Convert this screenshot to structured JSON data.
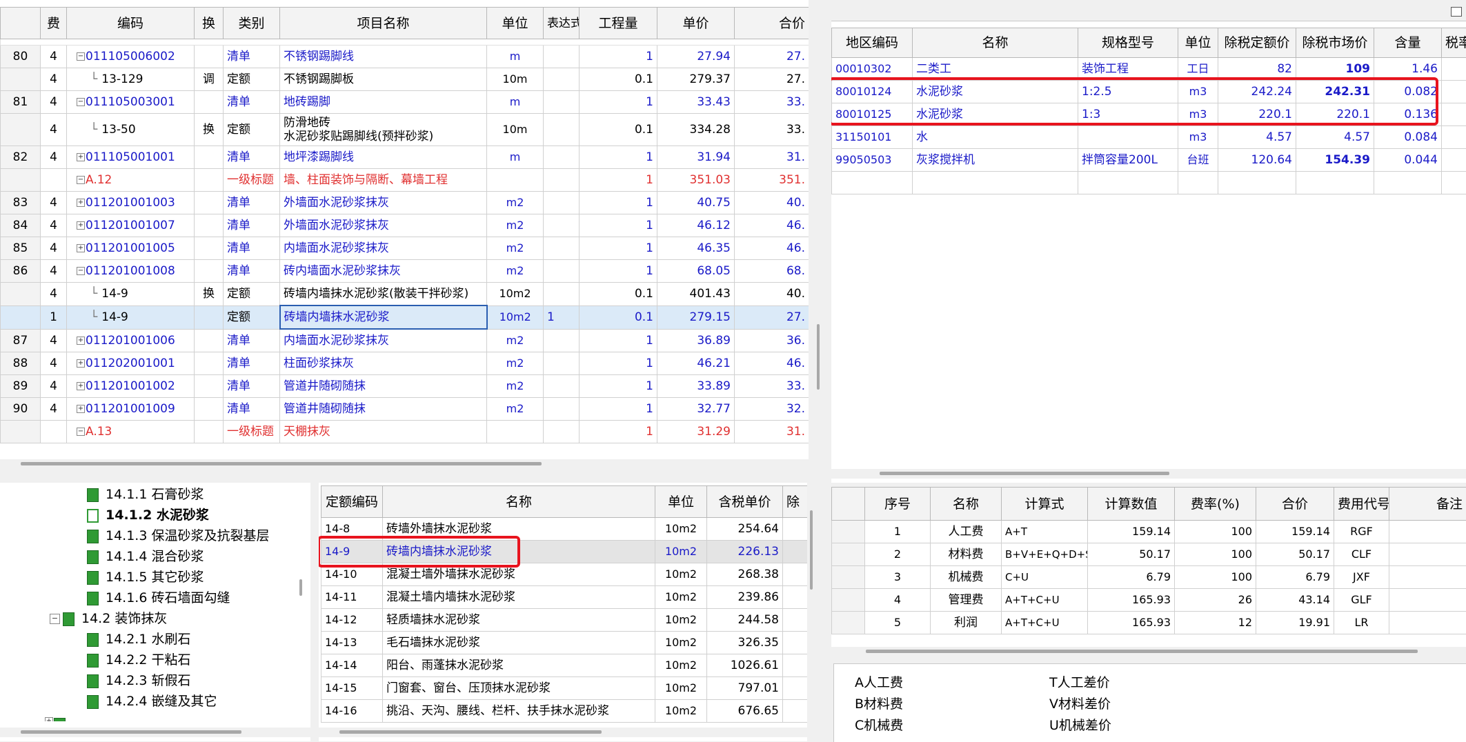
{
  "main_grid": {
    "headers": [
      "费",
      "编码",
      "换",
      "类别",
      "项目名称",
      "单位",
      "表达式",
      "工程量",
      "单价",
      "合价"
    ],
    "rows": [
      {
        "no": "80",
        "fee": "4",
        "code": "011105006002",
        "tree": "minus",
        "indent": 0,
        "swap": "",
        "type": "清单",
        "name": "不锈钢踢脚线",
        "unit": "m",
        "expr": "",
        "qty": "1",
        "price": "27.94",
        "total": "27.",
        "style": "blue"
      },
      {
        "no": "",
        "fee": "4",
        "code": "13-129",
        "tree": "leaf",
        "indent": 1,
        "swap": "调",
        "type": "定额",
        "name": "不锈钢踢脚板",
        "unit": "10m",
        "expr": "",
        "qty": "0.1",
        "price": "279.37",
        "total": "27.",
        "style": "black"
      },
      {
        "no": "81",
        "fee": "4",
        "code": "011105003001",
        "tree": "minus",
        "indent": 0,
        "swap": "",
        "type": "清单",
        "name": "地砖踢脚",
        "unit": "m",
        "expr": "",
        "qty": "1",
        "price": "33.43",
        "total": "33.",
        "style": "blue"
      },
      {
        "no": "",
        "fee": "4",
        "code": "13-50",
        "tree": "leaf",
        "indent": 1,
        "swap": "换",
        "type": "定额",
        "name": "防滑地砖",
        "name2": "水泥砂浆贴踢脚线(预拌砂浆)",
        "unit": "10m",
        "expr": "",
        "qty": "0.1",
        "price": "334.28",
        "total": "33.",
        "style": "black",
        "tall": true
      },
      {
        "no": "82",
        "fee": "4",
        "code": "011105001001",
        "tree": "plus",
        "indent": 0,
        "swap": "",
        "type": "清单",
        "name": "地坪漆踢脚线",
        "unit": "m",
        "expr": "",
        "qty": "1",
        "price": "31.94",
        "total": "31.",
        "style": "blue"
      },
      {
        "no": "",
        "fee": "",
        "code": "A.12",
        "tree": "minus",
        "indent": 0,
        "swap": "",
        "type": "一级标题",
        "name": "墙、柱面装饰与隔断、幕墙工程",
        "unit": "",
        "expr": "",
        "qty": "1",
        "price": "351.03",
        "total": "351.",
        "style": "red"
      },
      {
        "no": "83",
        "fee": "4",
        "code": "011201001003",
        "tree": "plus",
        "indent": 0,
        "swap": "",
        "type": "清单",
        "name": "外墙面水泥砂浆抹灰",
        "unit": "m2",
        "expr": "",
        "qty": "1",
        "price": "40.75",
        "total": "40.",
        "style": "blue"
      },
      {
        "no": "84",
        "fee": "4",
        "code": "011201001007",
        "tree": "plus",
        "indent": 0,
        "swap": "",
        "type": "清单",
        "name": "外墙面水泥砂浆抹灰",
        "unit": "m2",
        "expr": "",
        "qty": "1",
        "price": "46.12",
        "total": "46.",
        "style": "blue"
      },
      {
        "no": "85",
        "fee": "4",
        "code": "011201001005",
        "tree": "plus",
        "indent": 0,
        "swap": "",
        "type": "清单",
        "name": "内墙面水泥砂浆抹灰",
        "unit": "m2",
        "expr": "",
        "qty": "1",
        "price": "46.35",
        "total": "46.",
        "style": "blue"
      },
      {
        "no": "86",
        "fee": "4",
        "code": "011201001008",
        "tree": "minus",
        "indent": 0,
        "swap": "",
        "type": "清单",
        "name": "砖内墙面水泥砂浆抹灰",
        "unit": "m2",
        "expr": "",
        "qty": "1",
        "price": "68.05",
        "total": "68.",
        "style": "blue"
      },
      {
        "no": "",
        "fee": "4",
        "code": "14-9",
        "tree": "leaf",
        "indent": 1,
        "swap": "换",
        "type": "定额",
        "name": "砖墙内墙抹水泥砂浆(散装干拌砂浆)",
        "unit": "10m2",
        "expr": "",
        "qty": "0.1",
        "price": "401.43",
        "total": "40.",
        "style": "black"
      },
      {
        "no": "",
        "fee": "1",
        "code": "14-9",
        "tree": "leaf",
        "indent": 1,
        "swap": "",
        "type": "定额",
        "name": "砖墙内墙抹水泥砂浆",
        "unit": "10m2",
        "expr": "1",
        "qty": "0.1",
        "price": "279.15",
        "total": "27.",
        "style": "selected"
      },
      {
        "no": "87",
        "fee": "4",
        "code": "011201001006",
        "tree": "plus",
        "indent": 0,
        "swap": "",
        "type": "清单",
        "name": "内墙面水泥砂浆抹灰",
        "unit": "m2",
        "expr": "",
        "qty": "1",
        "price": "36.89",
        "total": "36.",
        "style": "blue"
      },
      {
        "no": "88",
        "fee": "4",
        "code": "011202001001",
        "tree": "plus",
        "indent": 0,
        "swap": "",
        "type": "清单",
        "name": "柱面砂浆抹灰",
        "unit": "m2",
        "expr": "",
        "qty": "1",
        "price": "46.21",
        "total": "46.",
        "style": "blue"
      },
      {
        "no": "89",
        "fee": "4",
        "code": "011201001002",
        "tree": "plus",
        "indent": 0,
        "swap": "",
        "type": "清单",
        "name": "管道井随砌随抹",
        "unit": "m2",
        "expr": "",
        "qty": "1",
        "price": "33.89",
        "total": "33.",
        "style": "blue"
      },
      {
        "no": "90",
        "fee": "4",
        "code": "011201001009",
        "tree": "plus",
        "indent": 0,
        "swap": "",
        "type": "清单",
        "name": "管道井随砌随抹",
        "unit": "m2",
        "expr": "",
        "qty": "1",
        "price": "32.77",
        "total": "32.",
        "style": "blue"
      },
      {
        "no": "",
        "fee": "",
        "code": "A.13",
        "tree": "minus",
        "indent": 0,
        "swap": "",
        "type": "一级标题",
        "name": "天棚抹灰",
        "unit": "",
        "expr": "",
        "qty": "1",
        "price": "31.29",
        "total": "31.",
        "style": "red"
      }
    ]
  },
  "material_grid": {
    "headers": [
      "地区编码",
      "名称",
      "规格型号",
      "单位",
      "除税定额价",
      "除税市场价",
      "含量",
      "税率("
    ],
    "rows": [
      {
        "code": "00010302",
        "name": "二类工",
        "spec": "装饰工程",
        "unit": "工日",
        "quota": "82",
        "market": "109",
        "qty": "1.46",
        "market_bold": true
      },
      {
        "code": "80010124",
        "name": "水泥砂浆",
        "spec": "1:2.5",
        "unit": "m3",
        "quota": "242.24",
        "market": "242.31",
        "qty": "0.082",
        "market_bold": true
      },
      {
        "code": "80010125",
        "name": "水泥砂浆",
        "spec": "1:3",
        "unit": "m3",
        "quota": "220.1",
        "market": "220.1",
        "qty": "0.136",
        "market_bold": false
      },
      {
        "code": "31150101",
        "name": "水",
        "spec": "",
        "unit": "m3",
        "quota": "4.57",
        "market": "4.57",
        "qty": "0.084",
        "market_bold": false
      },
      {
        "code": "99050503",
        "name": "灰浆搅拌机",
        "spec": "拌筒容量200L",
        "unit": "台班",
        "quota": "120.64",
        "market": "154.39",
        "qty": "0.044",
        "market_bold": true
      }
    ]
  },
  "category_tree": {
    "items": [
      {
        "label": "14.1.1  石膏砂浆",
        "level": 2,
        "open": false,
        "bold": false
      },
      {
        "label": "14.1.2  水泥砂浆",
        "level": 2,
        "open": true,
        "bold": true
      },
      {
        "label": "14.1.3  保温砂浆及抗裂基层",
        "level": 2,
        "open": false,
        "bold": false
      },
      {
        "label": "14.1.4  混合砂浆",
        "level": 2,
        "open": false,
        "bold": false
      },
      {
        "label": "14.1.5  其它砂浆",
        "level": 2,
        "open": false,
        "bold": false
      },
      {
        "label": "14.1.6  砖石墙面勾缝",
        "level": 2,
        "open": false,
        "bold": false
      },
      {
        "label": "14.2  装饰抹灰",
        "level": 1,
        "open": false,
        "bold": false,
        "expander": "minus"
      },
      {
        "label": "14.2.1  水刷石",
        "level": 2,
        "open": false,
        "bold": false
      },
      {
        "label": "14.2.2  干粘石",
        "level": 2,
        "open": false,
        "bold": false
      },
      {
        "label": "14.2.3  斩假石",
        "level": 2,
        "open": false,
        "bold": false
      },
      {
        "label": "14.2.4  嵌缝及其它",
        "level": 2,
        "open": false,
        "bold": false
      }
    ]
  },
  "quota_grid": {
    "headers": [
      "定额编码",
      "名称",
      "单位",
      "含税单价",
      "除"
    ],
    "rows": [
      {
        "code": "14-8",
        "name": "砖墙外墙抹水泥砂浆",
        "unit": "10m2",
        "price": "254.64"
      },
      {
        "code": "14-9",
        "name": "砖墙内墙抹水泥砂浆",
        "unit": "10m2",
        "price": "226.13",
        "highlight": true
      },
      {
        "code": "14-10",
        "name": "混凝土墙外墙抹水泥砂浆",
        "unit": "10m2",
        "price": "268.38"
      },
      {
        "code": "14-11",
        "name": "混凝土墙内墙抹水泥砂浆",
        "unit": "10m2",
        "price": "239.86"
      },
      {
        "code": "14-12",
        "name": "轻质墙抹水泥砂浆",
        "unit": "10m2",
        "price": "244.58"
      },
      {
        "code": "14-13",
        "name": "毛石墙抹水泥砂浆",
        "unit": "10m2",
        "price": "326.35"
      },
      {
        "code": "14-14",
        "name": "阳台、雨蓬抹水泥砂浆",
        "unit": "10m2",
        "price": "1026.61"
      },
      {
        "code": "14-15",
        "name": "门窗套、窗台、压顶抹水泥砂浆",
        "unit": "10m2",
        "price": "797.01"
      },
      {
        "code": "14-16",
        "name": "挑沿、天沟、腰线、栏杆、扶手抹水泥砂浆",
        "unit": "10m2",
        "price": "676.65"
      }
    ]
  },
  "fee_grid": {
    "headers": [
      "序号",
      "名称",
      "计算式",
      "计算数值",
      "费率(%)",
      "合价",
      "费用代号",
      "备注"
    ],
    "rows": [
      {
        "no": "1",
        "name": "人工费",
        "formula": "A+T",
        "value": "159.14",
        "rate": "100",
        "total": "159.14",
        "code": "RGF"
      },
      {
        "no": "2",
        "name": "材料费",
        "formula": "B+V+E+Q+D+SB",
        "value": "50.17",
        "rate": "100",
        "total": "50.17",
        "code": "CLF"
      },
      {
        "no": "3",
        "name": "机械费",
        "formula": "C+U",
        "value": "6.79",
        "rate": "100",
        "total": "6.79",
        "code": "JXF"
      },
      {
        "no": "4",
        "name": "管理费",
        "formula": "A+T+C+U",
        "value": "165.93",
        "rate": "26",
        "total": "43.14",
        "code": "GLF"
      },
      {
        "no": "5",
        "name": "利润",
        "formula": "A+T+C+U",
        "value": "165.93",
        "rate": "12",
        "total": "19.91",
        "code": "LR"
      }
    ]
  },
  "variable_legend": {
    "left": [
      "A人工费",
      "B材料费",
      "C机械费"
    ],
    "right": [
      "T人工差价",
      "V材料差价",
      "U机械差价"
    ]
  },
  "colors": {
    "highlight_box": "#e8141e",
    "link_blue": "#1a1ac8",
    "title_red": "#e03030",
    "selection": "#dbeaf8"
  }
}
